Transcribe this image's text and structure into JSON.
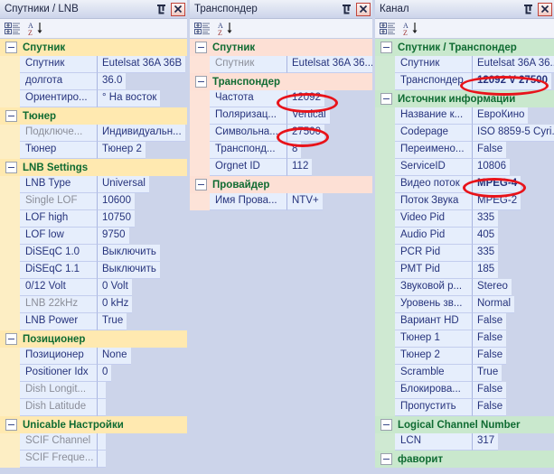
{
  "panels": [
    {
      "key": "satellite",
      "title": "Спутники / LNB",
      "pin": "⊥",
      "close": "x",
      "toolbar": {
        "categorize": "categorize-icon",
        "sort": "sort-az-icon"
      },
      "groups": [
        {
          "name": "Спутник",
          "rows": [
            {
              "label": "Спутник",
              "value": "Eutelsat 36A 36B",
              "dim": false
            },
            {
              "label": "долгота",
              "value": "36.0",
              "dim": false
            },
            {
              "label": "Ориентиро...",
              "value": "° На восток",
              "dim": false
            }
          ]
        },
        {
          "name": "Тюнер",
          "rows": [
            {
              "label": "Подключе...",
              "value": "Индивидуальн...",
              "dim": true
            },
            {
              "label": "Тюнер",
              "value": "Тюнер 2",
              "dim": false
            }
          ]
        },
        {
          "name": "LNB Settings",
          "rows": [
            {
              "label": "LNB Type",
              "value": "Universal",
              "dim": false
            },
            {
              "label": "Single LOF",
              "value": "10600",
              "dim": true
            },
            {
              "label": "LOF high",
              "value": "10750",
              "dim": false
            },
            {
              "label": "LOF low",
              "value": "9750",
              "dim": false
            },
            {
              "label": "DiSEqC 1.0",
              "value": "Выключить",
              "dim": false
            },
            {
              "label": "DiSEqC 1.1",
              "value": "Выключить",
              "dim": false
            },
            {
              "label": "0/12 Volt",
              "value": "0 Volt",
              "dim": false
            },
            {
              "label": "LNB 22kHz",
              "value": "0 kHz",
              "dim": true
            },
            {
              "label": "LNB Power",
              "value": "True",
              "dim": false
            }
          ]
        },
        {
          "name": "Позиционер",
          "rows": [
            {
              "label": "Позиционер",
              "value": "None",
              "dim": false
            },
            {
              "label": "Positioner Idx",
              "value": "0",
              "dim": false
            },
            {
              "label": "Dish Longit...",
              "value": "",
              "dim": true
            },
            {
              "label": "Dish Latitude",
              "value": "",
              "dim": true
            }
          ]
        },
        {
          "name": "Unicable Настройки",
          "rows": [
            {
              "label": "SCIF Channel",
              "value": "",
              "dim": true
            },
            {
              "label": "SCIF Freque...",
              "value": "",
              "dim": true
            }
          ]
        }
      ]
    },
    {
      "key": "transponder",
      "title": "Транспондер",
      "pin": "⊥",
      "close": "x",
      "toolbar": {
        "categorize": "categorize-icon",
        "sort": "sort-az-icon"
      },
      "groups": [
        {
          "name": "Спутник",
          "rows": [
            {
              "label": "Спутник",
              "value": "Eutelsat 36A 36...",
              "dim": true
            }
          ]
        },
        {
          "name": "Транспондер",
          "rows": [
            {
              "label": "Частота",
              "value": "12092",
              "dim": false
            },
            {
              "label": "Поляризац...",
              "value": "Vertical",
              "dim": false
            },
            {
              "label": "Символьна...",
              "value": "27500",
              "dim": false
            },
            {
              "label": "Транспонд...",
              "value": "8",
              "dim": false
            },
            {
              "label": "Orgnet ID",
              "value": "112",
              "dim": false
            }
          ]
        },
        {
          "name": "Провайдер",
          "rows": [
            {
              "label": "Имя Прова...",
              "value": "NTV+",
              "dim": false
            }
          ]
        }
      ]
    },
    {
      "key": "channel",
      "title": "Канал",
      "pin": "⊥",
      "close": "x",
      "toolbar": {
        "categorize": "categorize-icon",
        "sort": "sort-az-icon"
      },
      "groups": [
        {
          "name": "Спутник / Транспондер",
          "rows": [
            {
              "label": "Спутник",
              "value": "Eutelsat 36A 36...",
              "dim": false
            },
            {
              "label": "Транспондер",
              "value": "12092 V 27500",
              "dim": false,
              "bold": true
            }
          ]
        },
        {
          "name": "Источник информации",
          "rows": [
            {
              "label": "Название к...",
              "value": "ЕвроКино",
              "dim": false
            },
            {
              "label": "Codepage",
              "value": "ISO 8859-5 Cyri...",
              "dim": false
            },
            {
              "label": "Переимено...",
              "value": "False",
              "dim": false
            },
            {
              "label": "ServiceID",
              "value": "10806",
              "dim": false
            },
            {
              "label": "Видео поток",
              "value": "MPEG-4",
              "dim": false,
              "bold": true
            },
            {
              "label": "Поток Звука",
              "value": "MPEG-2",
              "dim": false
            },
            {
              "label": "Video Pid",
              "value": "335",
              "dim": false
            },
            {
              "label": "Audio Pid",
              "value": "405",
              "dim": false
            },
            {
              "label": "PCR Pid",
              "value": "335",
              "dim": false
            },
            {
              "label": "PMT Pid",
              "value": "185",
              "dim": false
            },
            {
              "label": "Звуковой р...",
              "value": "Stereo",
              "dim": false
            },
            {
              "label": "Уровень зв...",
              "value": "Normal",
              "dim": false
            },
            {
              "label": "Вариант HD",
              "value": "False",
              "dim": false
            },
            {
              "label": "Тюнер 1",
              "value": "False",
              "dim": false
            },
            {
              "label": "Тюнер 2",
              "value": "False",
              "dim": false
            },
            {
              "label": "Scramble",
              "value": "True",
              "dim": false
            },
            {
              "label": "Блокирова...",
              "value": "False",
              "dim": false
            },
            {
              "label": "Пропустить",
              "value": "False",
              "dim": false
            }
          ]
        },
        {
          "name": "Logical Channel Number",
          "rows": [
            {
              "label": "LCN",
              "value": "317",
              "dim": false
            }
          ]
        },
        {
          "name": "фаворит",
          "rows": []
        }
      ]
    }
  ],
  "annotations": {
    "color": "#e8131a",
    "highlights": [
      {
        "name": "frequency-highlight",
        "target": "12092"
      },
      {
        "name": "symbolrate-highlight",
        "target": "27500"
      },
      {
        "name": "transponder-id-highlight",
        "target": "12092 V 27500"
      },
      {
        "name": "video-stream-highlight",
        "target": "MPEG-4"
      }
    ]
  }
}
